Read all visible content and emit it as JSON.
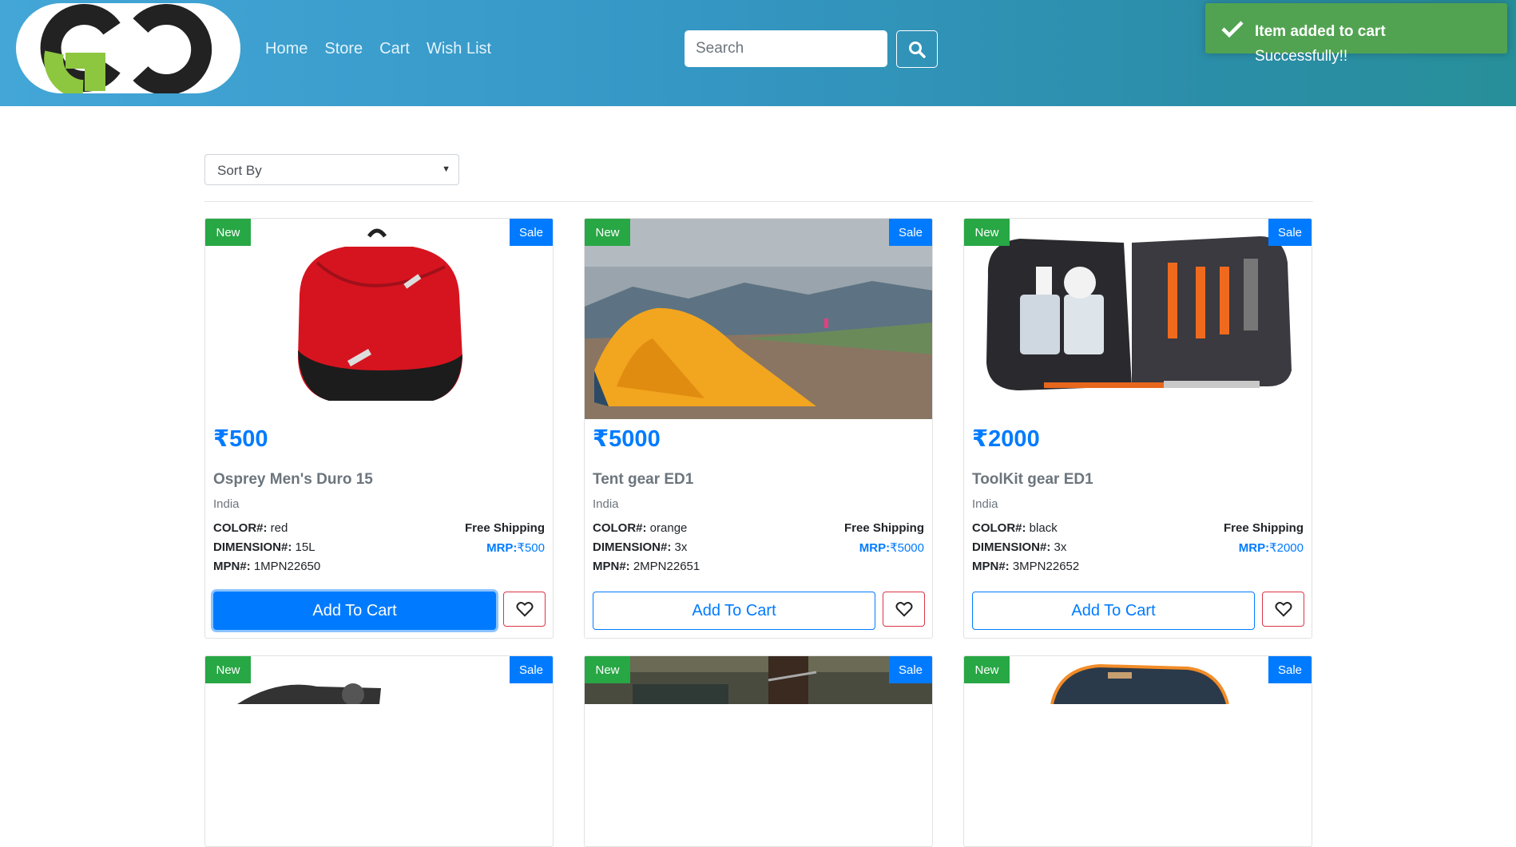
{
  "header": {
    "nav": [
      "Home",
      "Store",
      "Cart",
      "Wish List"
    ],
    "search_placeholder": "Search"
  },
  "toast": {
    "title": "Item added to cart",
    "message": "Successfully!!"
  },
  "sort": {
    "selected": "Sort By"
  },
  "labels": {
    "new": "New",
    "sale": "Sale",
    "color": "COLOR#:",
    "dimension": "DIMENSION#:",
    "mpn": "MPN#:",
    "mrp": "MRP:",
    "add_to_cart": "Add To Cart"
  },
  "products": [
    {
      "price": "₹500",
      "name": "Osprey Men's Duro 15",
      "origin": "India",
      "color": "red",
      "dimension": "15L",
      "mpn": "1MPN22650",
      "shipping": "Free Shipping",
      "mrp": "₹500"
    },
    {
      "price": "₹5000",
      "name": "Tent gear ED1",
      "origin": "India",
      "color": "orange",
      "dimension": "3x",
      "mpn": "2MPN22651",
      "shipping": "Free Shipping",
      "mrp": "₹5000"
    },
    {
      "price": "₹2000",
      "name": "ToolKit gear ED1",
      "origin": "India",
      "color": "black",
      "dimension": "3x",
      "mpn": "3MPN22652",
      "shipping": "Free Shipping",
      "mrp": "₹2000"
    }
  ],
  "colors": {
    "primary": "#007bff",
    "success": "#28a745",
    "danger": "#dc3545",
    "toast": "#51a351"
  }
}
